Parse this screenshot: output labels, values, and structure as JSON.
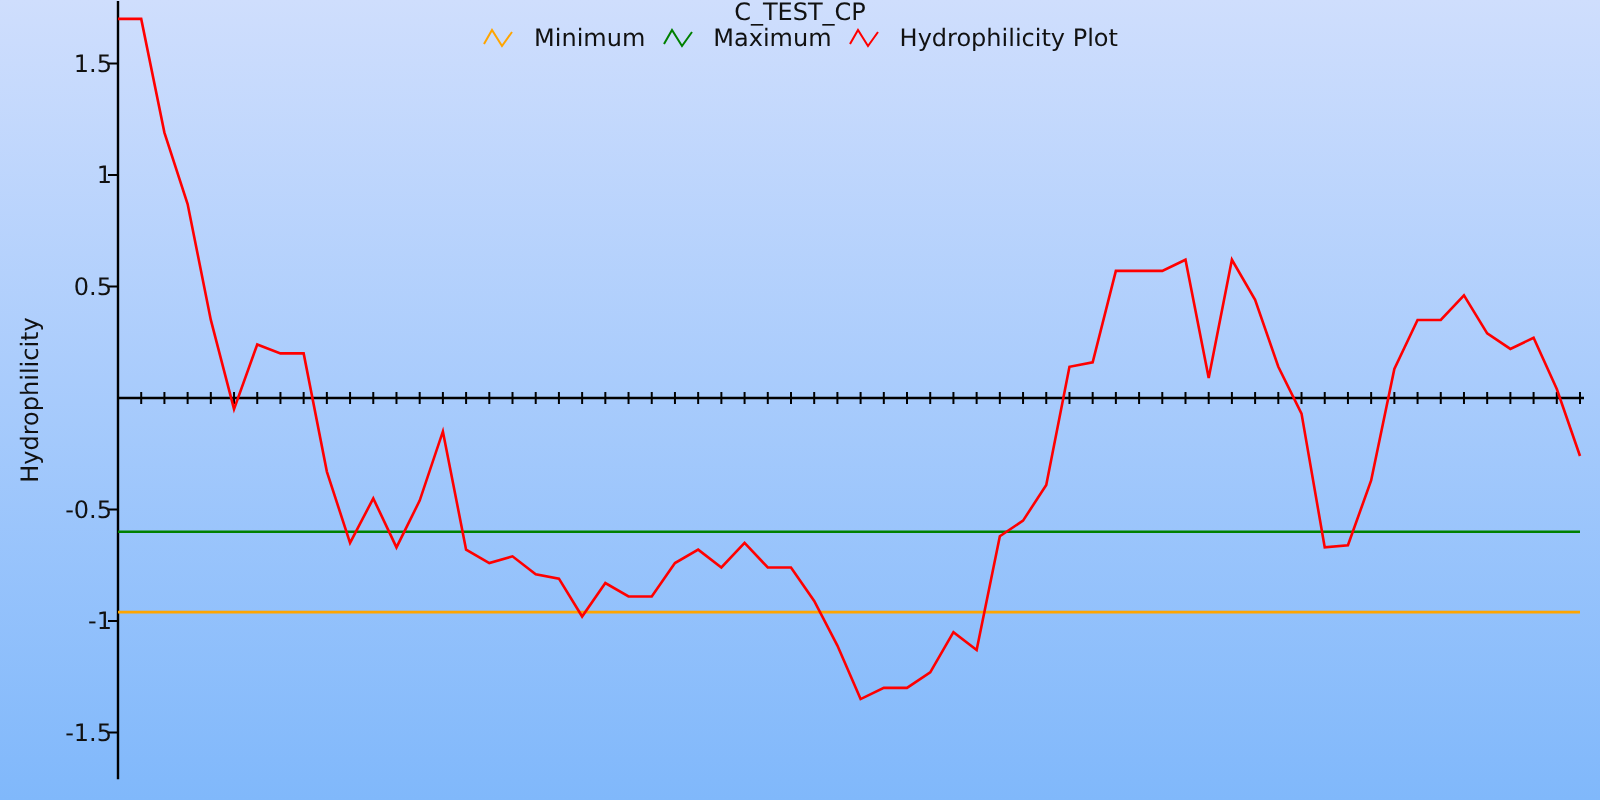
{
  "chart": {
    "chart_data": {
      "type": "line",
      "title": "C_TEST_CP",
      "ylabel": "Hydrophilicity",
      "ylim": [
        -1.71,
        1.78
      ],
      "yticks": [
        {
          "value": -1.5,
          "label": "-1.5"
        },
        {
          "value": -1,
          "label": "-1"
        },
        {
          "value": -0.5,
          "label": "-0.5"
        },
        {
          "value": 0.5,
          "label": "0.5"
        },
        {
          "value": 1,
          "label": "1"
        },
        {
          "value": 1.5,
          "label": "1.5"
        }
      ],
      "series": [
        {
          "name": "Minimum",
          "color": "#ffa500",
          "values": [
            -0.96,
            -0.96,
            -0.96,
            -0.96,
            -0.96,
            -0.96,
            -0.96,
            -0.96,
            -0.96,
            -0.96,
            -0.96,
            -0.96,
            -0.96,
            -0.96,
            -0.96,
            -0.96,
            -0.96,
            -0.96,
            -0.96,
            -0.96,
            -0.96,
            -0.96,
            -0.96,
            -0.96,
            -0.96,
            -0.96,
            -0.96,
            -0.96,
            -0.96,
            -0.96,
            -0.96,
            -0.96,
            -0.96,
            -0.96,
            -0.96,
            -0.96,
            -0.96,
            -0.96,
            -0.96,
            -0.96,
            -0.96,
            -0.96,
            -0.96,
            -0.96,
            -0.96,
            -0.96,
            -0.96,
            -0.96,
            -0.96,
            -0.96,
            -0.96,
            -0.96,
            -0.96,
            -0.96,
            -0.96,
            -0.96,
            -0.96,
            -0.96,
            -0.96,
            -0.96,
            -0.96,
            -0.96,
            -0.96,
            -0.96
          ]
        },
        {
          "name": "Maximum",
          "color": "#008000",
          "values": [
            -0.6,
            -0.6,
            -0.6,
            -0.6,
            -0.6,
            -0.6,
            -0.6,
            -0.6,
            -0.6,
            -0.6,
            -0.6,
            -0.6,
            -0.6,
            -0.6,
            -0.6,
            -0.6,
            -0.6,
            -0.6,
            -0.6,
            -0.6,
            -0.6,
            -0.6,
            -0.6,
            -0.6,
            -0.6,
            -0.6,
            -0.6,
            -0.6,
            -0.6,
            -0.6,
            -0.6,
            -0.6,
            -0.6,
            -0.6,
            -0.6,
            -0.6,
            -0.6,
            -0.6,
            -0.6,
            -0.6,
            -0.6,
            -0.6,
            -0.6,
            -0.6,
            -0.6,
            -0.6,
            -0.6,
            -0.6,
            -0.6,
            -0.6,
            -0.6,
            -0.6,
            -0.6,
            -0.6,
            -0.6,
            -0.6,
            -0.6,
            -0.6,
            -0.6,
            -0.6,
            -0.6,
            -0.6,
            -0.6,
            -0.6
          ]
        },
        {
          "name": "Hydrophilicity Plot",
          "color": "#ff0000",
          "values": [
            1.7,
            1.7,
            1.19,
            0.87,
            0.35,
            -0.05,
            0.24,
            0.2,
            0.2,
            -0.33,
            -0.65,
            -0.45,
            -0.67,
            -0.46,
            -0.15,
            -0.68,
            -0.74,
            -0.71,
            -0.79,
            -0.81,
            -0.98,
            -0.83,
            -0.89,
            -0.89,
            -0.74,
            -0.68,
            -0.76,
            -0.65,
            -0.76,
            -0.76,
            -0.91,
            -1.11,
            -1.35,
            -1.3,
            -1.3,
            -1.23,
            -1.05,
            -1.13,
            -0.62,
            -0.55,
            -0.39,
            0.14,
            0.16,
            0.57,
            0.57,
            0.57,
            0.62,
            0.09,
            0.62,
            0.44,
            0.14,
            -0.07,
            -0.67,
            -0.66,
            -0.37,
            0.13,
            0.35,
            0.35,
            0.46,
            0.29,
            0.22,
            0.27,
            0.04,
            -0.26
          ]
        }
      ]
    }
  }
}
